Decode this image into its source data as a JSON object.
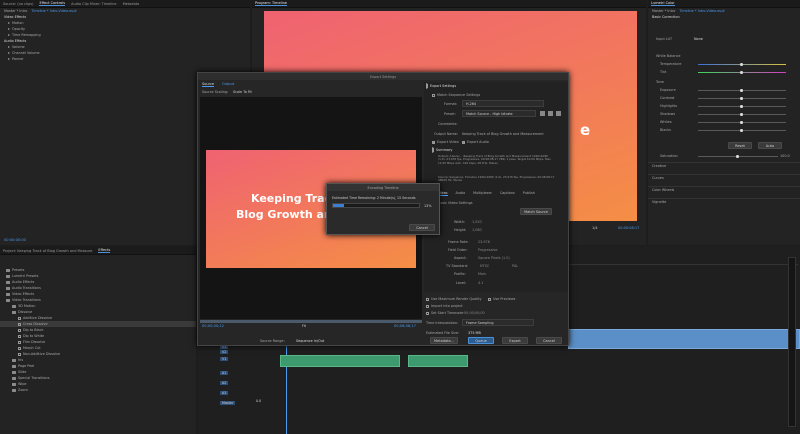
{
  "left_top": {
    "tabs": [
      "Source: (no clips)",
      "Effect Controls",
      "Audio Clip Mixer: Timeline",
      "Metadata"
    ],
    "breadcrumb": "Master * Intro",
    "breadcrumb_target": "Timeline * Intro-Video.mp4",
    "section_video": "Video Effects",
    "rows": [
      "Motion",
      "Opacity",
      "Time Remapping"
    ],
    "section_audio": "Audio Effects",
    "audio_rows": [
      "Volume",
      "Channel Volume",
      "Panner"
    ],
    "timecode": "00:00:00:00"
  },
  "program": {
    "title": "Program: Timeline",
    "timecode_right": "00:00:08:17",
    "zoom": "1/4",
    "frame_text": "e"
  },
  "export_dialog": {
    "title": "Export Settings",
    "tabs": [
      "Source",
      "Output"
    ],
    "source_scaling_label": "Source Scaling:",
    "source_scaling_value": "Scale To Fit",
    "preview_text_line1": "Keeping Track",
    "preview_text_line2": "Blog Growth and",
    "export_settings_header": "Export Settings",
    "match_sequence": "Match Sequence Settings",
    "format_label": "Format:",
    "format_value": "H.264",
    "preset_label": "Preset:",
    "preset_value": "Match Source - High bitrate",
    "comments_label": "Comments:",
    "output_name_label": "Output Name:",
    "output_name_value": "Keeping Track of Blog Growth and Measurement",
    "export_video": "Export Video",
    "export_audio": "Export Audio",
    "summary_header": "Summary",
    "summary_output": "Output: /Users/... /Keeping Track of Blog Growth and Measurement 1920x1080 (1.0), 23.976 fps, Progressive, 00:08:08:17 VBR, 1 pass, Target 10.00 Mbps, Max 12.00 Mbps AAC, 320 kbps, 48 kHz, Stereo",
    "summary_source": "Source: Sequence, Timeline 1920x1080 (1.0), 23.976 fps, Progressive, 00:08:08:17 48000 Hz, Stereo",
    "subtabs": [
      "Video",
      "Audio",
      "Multiplexer",
      "Captions",
      "Publish"
    ],
    "basic_video": "Basic Video Settings",
    "match_source": "Match Source",
    "width_label": "Width:",
    "width_value": "1,920",
    "height_label": "Height:",
    "height_value": "1,080",
    "frame_rate_label": "Frame Rate:",
    "frame_rate_value": "23.976",
    "field_order_label": "Field Order:",
    "field_order_value": "Progressive",
    "aspect_label": "Aspect:",
    "aspect_value": "Square Pixels (1.0)",
    "tv_standard_label": "TV Standard:",
    "ntsc": "NTSC",
    "pal": "PAL",
    "profile_label": "Profile:",
    "profile_value": "Main",
    "level_label": "Level:",
    "level_value": "4.1",
    "max_render": "Use Maximum Render Quality",
    "use_previews": "Use Previews",
    "import_project": "Import into project",
    "set_start_tc": "Set Start Timecode",
    "start_tc_value": "00;00;00;00",
    "time_interp_label": "Time Interpolation:",
    "time_interp_value": "Frame Sampling",
    "file_size_label": "Estimated File Size:",
    "file_size_value": "375 MB",
    "btn_metadata": "Metadata...",
    "btn_queue": "Queue",
    "btn_export": "Export",
    "btn_cancel": "Cancel",
    "src_tc_left": "00;00;00;12",
    "src_tc_right": "00;08;08;17",
    "fit_label": "Fit",
    "source_range_label": "Source Range:",
    "source_range_value": "Sequence In/Out"
  },
  "progress": {
    "title": "Encoding Timeline",
    "message": "Estimated Time Remaining: 2 Minute(s), 15 Seconds",
    "percent_text": "13%",
    "percent": 13,
    "cancel": "Cancel"
  },
  "project": {
    "tabs": [
      "Project: Keeping Track of Blog Growth and Measure",
      "Effects"
    ],
    "items": [
      "Presets",
      "Lumetri Presets",
      "Audio Effects",
      "Audio Transitions",
      "Video Effects",
      "Video Transitions",
      "3D Motion",
      "Dissolve",
      "Additive Dissolve",
      "Cross Dissolve",
      "Dip to Black",
      "Dip to White",
      "Film Dissolve",
      "Morph Cut",
      "Non-Additive Dissolve",
      "Iris",
      "Page Peel",
      "Slide",
      "Special Transitions",
      "Wipe",
      "Zoom"
    ]
  },
  "lumetri": {
    "title": "Lumetri Color",
    "breadcrumb": "Master * Intro",
    "breadcrumb_target": "Timeline * Intro-Video.mp4",
    "basic": "Basic Correction",
    "input_lut": "Input LUT",
    "input_lut_value": "None",
    "white_balance": "White Balance",
    "temperature": "Temperature",
    "tint": "Tint",
    "tone": "Tone",
    "exposure": "Exposure",
    "contrast": "Contrast",
    "highlights": "Highlights",
    "shadows": "Shadows",
    "whites": "Whites",
    "blacks": "Blacks",
    "reset": "Reset",
    "auto": "Auto",
    "saturation": "Saturation",
    "saturation_value": "100.0",
    "sections": [
      "Creative",
      "Curves",
      "Color Wheels",
      "Vignette"
    ]
  },
  "timeline": {
    "tracks": [
      "V3",
      "V2",
      "V1",
      "A1",
      "A2",
      "A3",
      "Master"
    ],
    "master_value": "0.0"
  },
  "colors": {
    "accent": "#4a9bf0",
    "video_clip": "#3d9a6e",
    "audio_clip": "#5b8fc7"
  }
}
